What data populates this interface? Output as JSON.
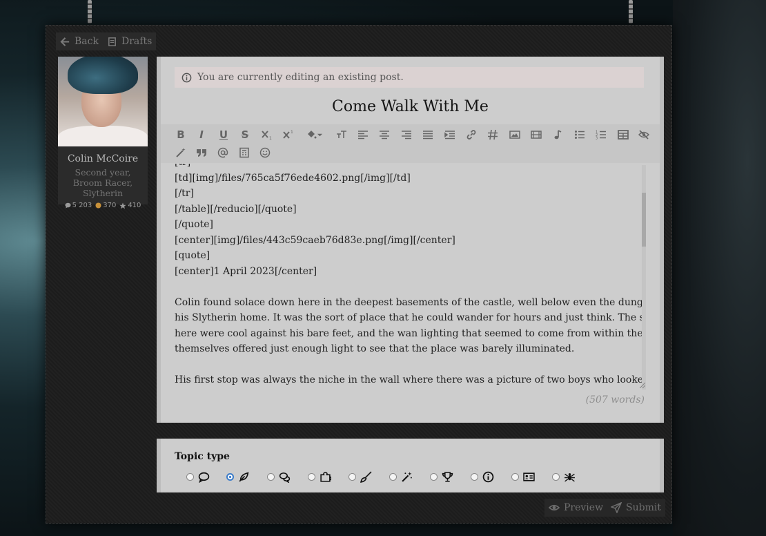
{
  "nav": {
    "back_label": "Back",
    "drafts_label": "Drafts"
  },
  "profile": {
    "name": "Colin McCoire",
    "rank": "Second year, Broom Racer, Slytherin",
    "posts": "5 203",
    "coins": "370",
    "stars": "410"
  },
  "editor": {
    "notice": "You are currently editing an existing post.",
    "title": "Come Walk With Me",
    "lines": [
      "[tr]",
      "[td][img]/files/765ca5f76ede4602.png[/img][/td]",
      "[/tr]",
      "[/table][/reducio][/quote]",
      "[/quote]",
      "[center][img]/files/443c59caeb76d83e.png[/img][/center]",
      "[quote]",
      "[center]1 April 2023[/center]",
      "",
      "Colin found solace down here in the deepest basements of the castle, well below even the dungeons of",
      "his Slytherin home. It was the sort of place that he could wander for hours and just think. The stones",
      "here were cool against his bare feet, and the wan lighting that seemed to come from within the stones",
      "themselves offered just enough light to see that the place was barely illuminated.",
      "",
      "His first stop was always the niche in the wall where there was a picture of two boys who looked alike,"
    ],
    "word_count": "(507 words)"
  },
  "topic": {
    "label": "Topic type",
    "selected_index": 1
  },
  "actions": {
    "preview_label": "Preview",
    "submit_label": "Submit"
  },
  "colors": {
    "accent": "#3a7bc8",
    "panel": "#1d1d1d",
    "editor_bg": "#cdcdcd",
    "notice_bg": "#dbd2d2"
  }
}
